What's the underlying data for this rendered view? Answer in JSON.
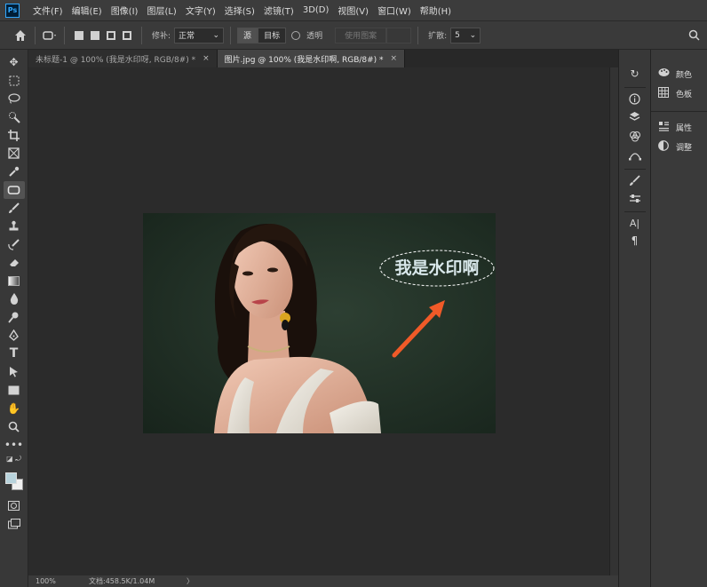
{
  "app": {
    "logo": "Ps"
  },
  "menu": [
    "文件(F)",
    "编辑(E)",
    "图像(I)",
    "图层(L)",
    "文字(Y)",
    "选择(S)",
    "滤镜(T)",
    "3D(D)",
    "视图(V)",
    "窗口(W)",
    "帮助(H)"
  ],
  "options": {
    "fill_label": "修补:",
    "fill_value": "正常",
    "source_label": "源",
    "dest_label": "目标",
    "transparent_label": "透明",
    "use_pattern_label": "使用图案",
    "spread_label": "扩散:",
    "spread_value": "5"
  },
  "tabs": [
    {
      "label": "未标题-1 @ 100% (我是水印呀, RGB/8#) *"
    },
    {
      "label": "图片.jpg @ 100% (我是水印啊, RGB/8#) *"
    }
  ],
  "tab_close": "×",
  "canvas": {
    "watermark": "我是水印啊",
    "arrow_color": "#f05a28",
    "background_color": "#2b2b2b"
  },
  "status": {
    "zoom": "100%",
    "doc": "文档:458.5K/1.04M",
    "chevron": "〉"
  },
  "panels": [
    {
      "label": "颜色",
      "icon": "palette-icon"
    },
    {
      "label": "色板",
      "icon": "grid-icon"
    },
    {
      "label": "属性",
      "icon": "properties-icon"
    },
    {
      "label": "调整",
      "icon": "adjust-icon"
    }
  ],
  "colors": {
    "foreground": "#b8d3dc",
    "background": "#f0f0f0"
  }
}
